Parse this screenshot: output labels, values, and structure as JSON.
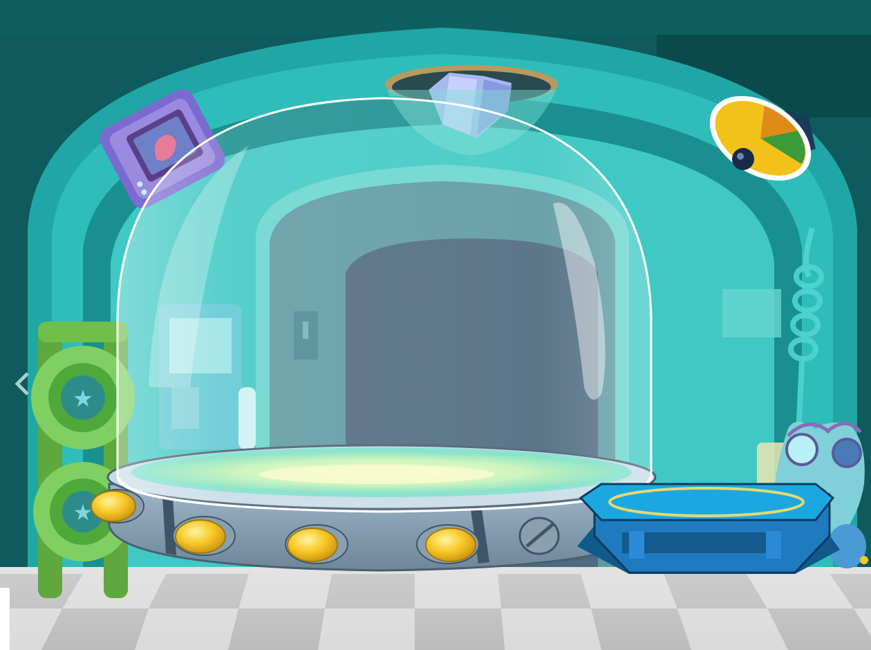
{
  "scene": {
    "name": "lab-room",
    "colors": {
      "wall_dark": "#0f5a5c",
      "arch_light": "#3fc9c6",
      "arch_mid": "#1fa3a3",
      "doorway": "#4f6a80",
      "floor_light": "#dcdcdc",
      "floor_dark": "#b9b9b9",
      "pad_blue": "#1b8fd0",
      "lamp_yellow": "#f2c21b",
      "rivet_gold": "#f7c928"
    },
    "objects": [
      {
        "name": "glass-dome",
        "description_icon": "dome-icon"
      },
      {
        "name": "dome-base-platform",
        "rivets": 5
      },
      {
        "name": "blue-pedestal"
      },
      {
        "name": "ceiling-crystal-lamp"
      },
      {
        "name": "wall-gauge-lamp"
      },
      {
        "name": "floating-tablet"
      },
      {
        "name": "green-tire-rack"
      },
      {
        "name": "helper-robot"
      }
    ]
  }
}
